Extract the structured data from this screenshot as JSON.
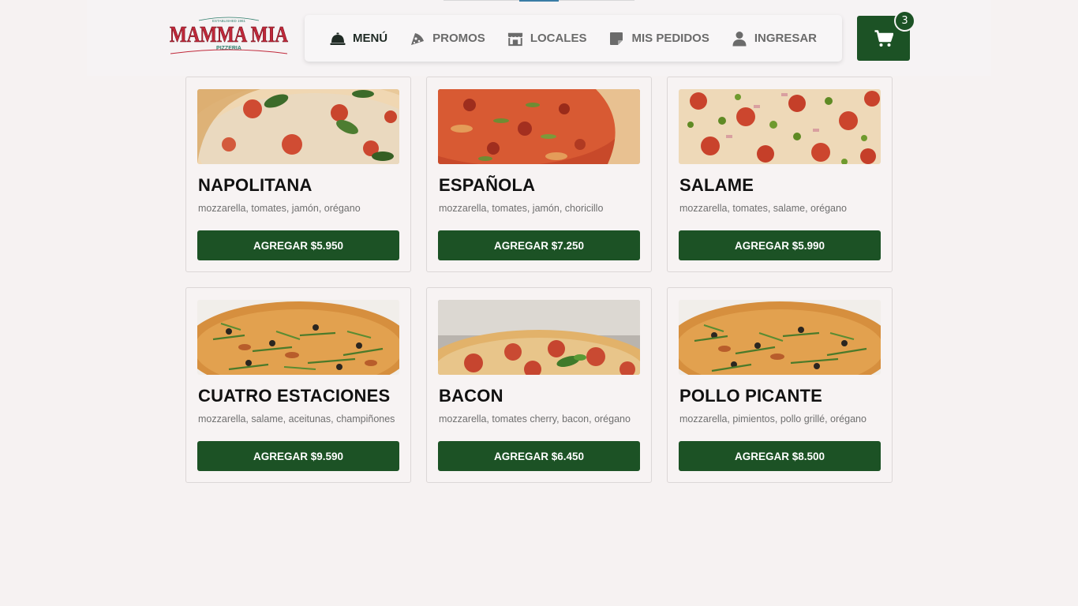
{
  "brand": {
    "name": "MAMMA MIA",
    "sub": "PIZZERIA",
    "tagline": "ESTABLISHED 1961"
  },
  "nav": {
    "items": [
      {
        "label": "MENÚ",
        "icon": "service-bell-icon",
        "active": true
      },
      {
        "label": "PROMOS",
        "icon": "pizza-slice-icon",
        "active": false
      },
      {
        "label": "LOCALES",
        "icon": "store-icon",
        "active": false
      },
      {
        "label": "MIS PEDIDOS",
        "icon": "note-icon",
        "active": false
      },
      {
        "label": "INGRESAR",
        "icon": "user-icon",
        "active": false
      }
    ]
  },
  "cart": {
    "icon": "cart-icon",
    "count": "3"
  },
  "products": [
    {
      "name": "NAPOLITANA",
      "desc": "mozzarella, tomates, jamón, orégano",
      "button": "AGREGAR $5.950",
      "image": "pizza-napolitana"
    },
    {
      "name": "ESPAÑOLA",
      "desc": "mozzarella, tomates, jamón, choricillo",
      "button": "AGREGAR $7.250",
      "image": "pizza-espanola"
    },
    {
      "name": "SALAME",
      "desc": "mozzarella, tomates, salame, orégano",
      "button": "AGREGAR $5.990",
      "image": "pizza-salame"
    },
    {
      "name": "CUATRO ESTACIONES",
      "desc": "mozzarella, salame, aceitunas, champiñones",
      "button": "AGREGAR $9.590",
      "image": "pizza-cuatro-estaciones"
    },
    {
      "name": "BACON",
      "desc": "mozzarella, tomates cherry, bacon, orégano",
      "button": "AGREGAR $6.450",
      "image": "pizza-bacon"
    },
    {
      "name": "POLLO PICANTE",
      "desc": "mozzarella, pimientos, pollo grillé, orégano",
      "button": "AGREGAR $8.500",
      "image": "pizza-pollo-picante"
    }
  ],
  "colors": {
    "primary": "#1c5225",
    "background": "#f6f2f2",
    "logo_red": "#c0283a",
    "logo_teal": "#2e7d6b"
  }
}
